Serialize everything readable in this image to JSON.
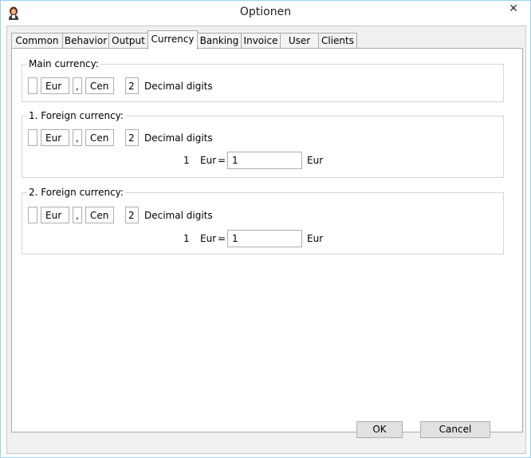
{
  "window": {
    "title": "Optionen",
    "close_glyph": "✕",
    "app_icon": "person-icon"
  },
  "tabs": [
    {
      "label": "Common"
    },
    {
      "label": "Behavior"
    },
    {
      "label": "Output"
    },
    {
      "label": "Currency"
    },
    {
      "label": "Banking"
    },
    {
      "label": "Invoice"
    },
    {
      "label": "User"
    },
    {
      "label": "Clients"
    }
  ],
  "active_tab": "Currency",
  "main_currency": {
    "label": "Main currency:",
    "symbol": "",
    "unit": "Eur",
    "separator": ",",
    "sub_unit": "Cen",
    "decimals": "2",
    "decimals_label": "Decimal digits"
  },
  "foreign1": {
    "label": "1. Foreign currency:",
    "symbol": "",
    "unit": "Eur",
    "separator": ",",
    "sub_unit": "Cen",
    "decimals": "2",
    "decimals_label": "Decimal digits",
    "rate_amount": "1",
    "rate_from": "Eur",
    "equals": "=",
    "rate_value": "1",
    "rate_to": "Eur"
  },
  "foreign2": {
    "label": "2. Foreign currency:",
    "symbol": "",
    "unit": "Eur",
    "separator": ",",
    "sub_unit": "Cen",
    "decimals": "2",
    "decimals_label": "Decimal digits",
    "rate_amount": "1",
    "rate_from": "Eur",
    "equals": "=",
    "rate_value": "1",
    "rate_to": "Eur"
  },
  "buttons": {
    "ok": "OK",
    "cancel": "Cancel"
  }
}
